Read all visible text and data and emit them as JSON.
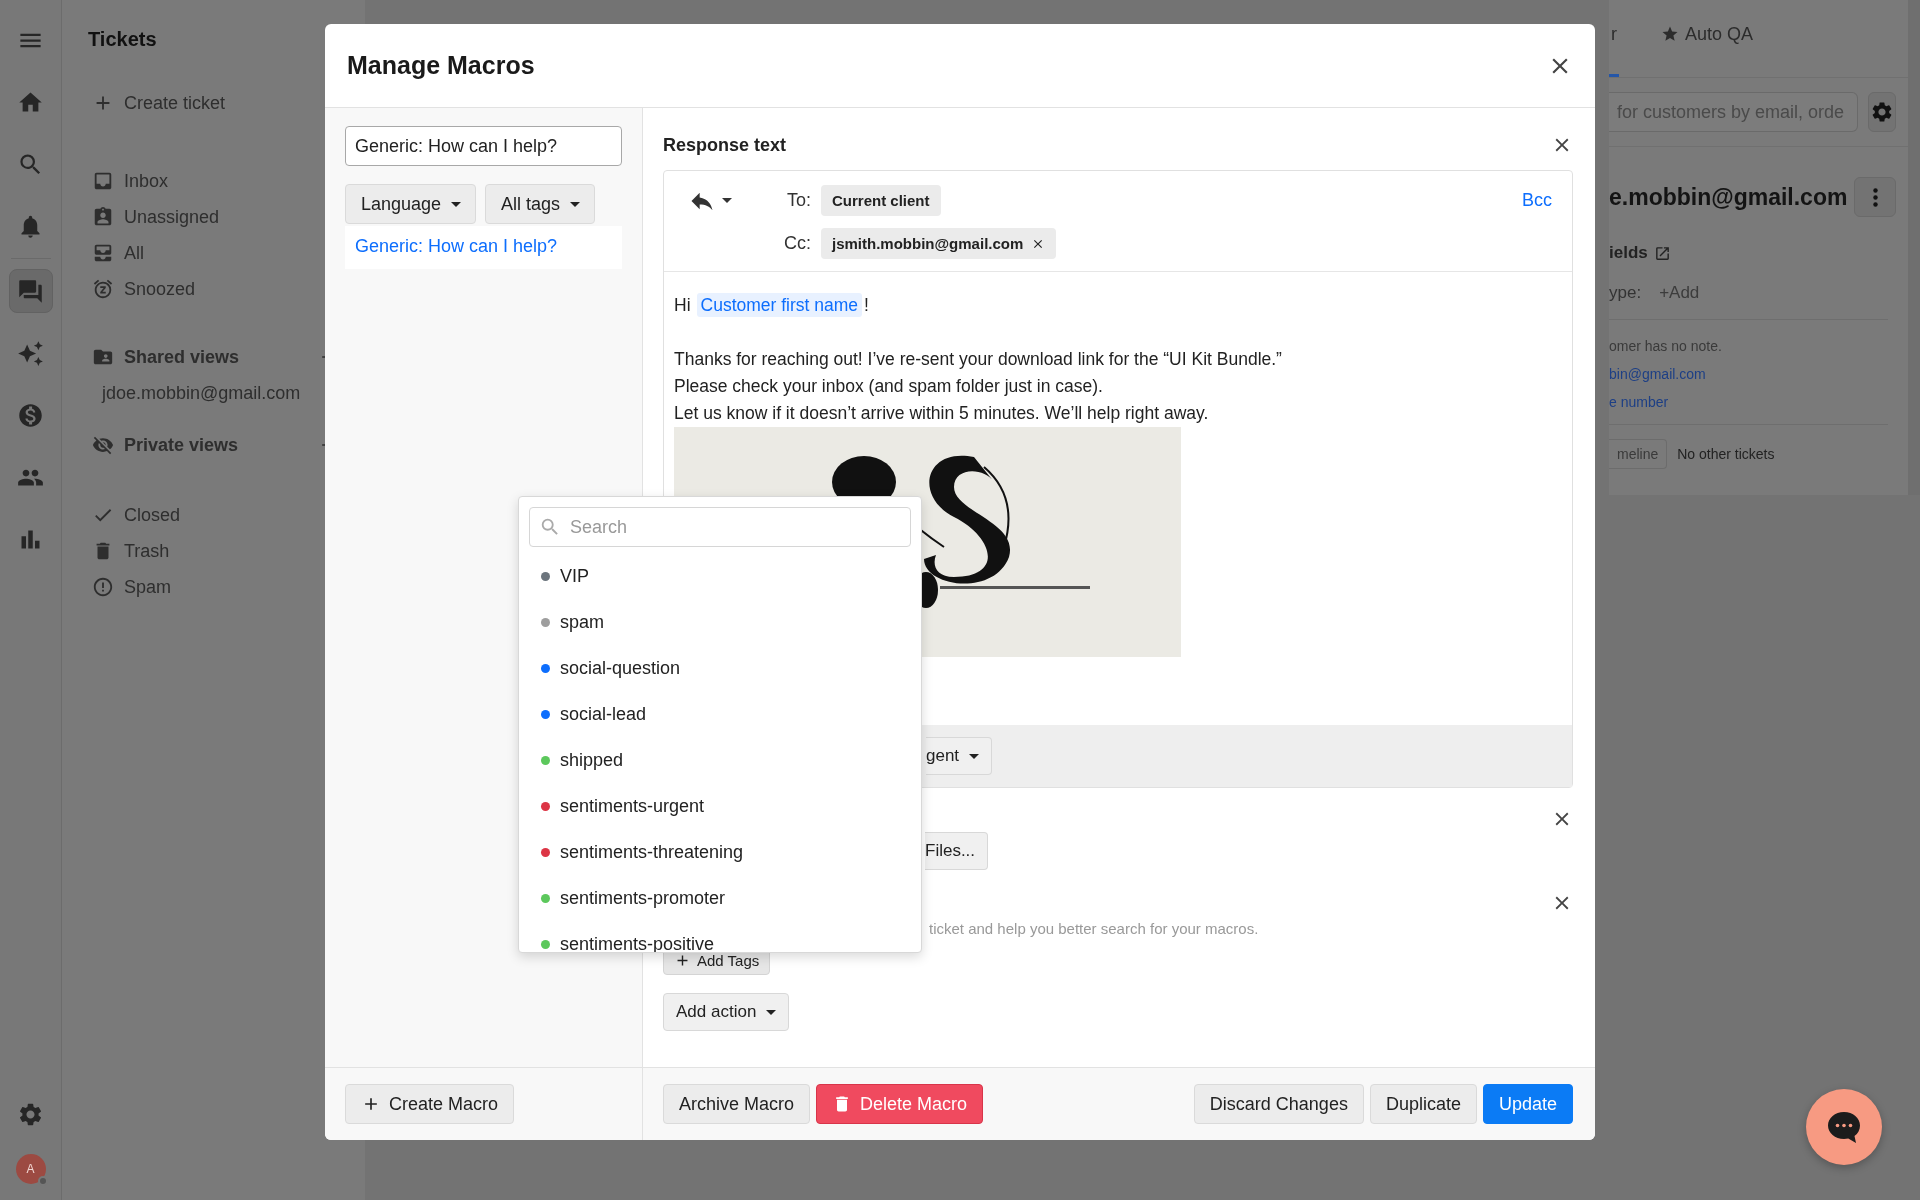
{
  "rail": {
    "items": [
      {
        "selected": false
      },
      {
        "selected": false
      },
      {
        "selected": false
      },
      {
        "selected": false
      },
      {
        "selected": true
      },
      {
        "selected": false
      },
      {
        "selected": false
      },
      {
        "selected": false
      },
      {
        "selected": false
      }
    ],
    "avatar": "A"
  },
  "tickets_panel": {
    "title": "Tickets",
    "create": "Create ticket",
    "folders": [
      "Inbox",
      "Unassigned",
      "All",
      "Snoozed"
    ],
    "shared_views": {
      "title": "Shared views",
      "items": [
        "jdoe.mobbin@gmail.com"
      ]
    },
    "private_views": {
      "title": "Private views"
    },
    "status_folders": [
      "Closed",
      "Trash",
      "Spam"
    ]
  },
  "customer_panel": {
    "tabs": [
      {
        "label": "r",
        "selected": true
      },
      {
        "label": "Auto QA",
        "selected": false
      }
    ],
    "search_placeholder": "for customers by email, orde",
    "customer_email": "e.mobbin@gmail.com",
    "fields_title": "ields",
    "field": {
      "label": "ype:",
      "value": "+Add"
    },
    "note": "omer has no note.",
    "email_link": "bin@gmail.com",
    "phone_link": "e number",
    "timeline_button": "meline",
    "other_tickets": "No other tickets"
  },
  "modal": {
    "title": "Manage Macros",
    "macro_search": "Generic: How can I help?",
    "filters": [
      "Language",
      "All tags"
    ],
    "macros": [
      {
        "label": "Generic: How can I help?",
        "selected": true
      }
    ],
    "response": {
      "title": "Response text",
      "to_label": "To:",
      "to_chip": "Current client",
      "bcc": "Bcc",
      "cc_label": "Cc:",
      "cc_chips": [
        "jsmith.mobbin@gmail.com"
      ],
      "greeting": "Hi",
      "variable": "Customer first name",
      "greeting_end": "!",
      "lines": [
        "Thanks for reaching out! I’ve re-sent your download link for the “UI Kit Bundle.”",
        "Please check your inbox (and spam folder just in case).",
        "Let us know if it doesn’t arrive within 5 minutes. We’ll help right away."
      ],
      "image": {
        "kind": "picture"
      },
      "sender_button": "gent"
    },
    "attachments": {
      "button": "Files..."
    },
    "tags": {
      "hint": "ticket and help you better search for your macros.",
      "add_button": "Add Tags"
    },
    "add_action": "Add action",
    "create_button": "Create Macro",
    "footer_buttons": [
      {
        "label": "Archive Macro",
        "kind": "default"
      },
      {
        "label": "Delete Macro",
        "kind": "danger"
      },
      {
        "label": "Discard Changes",
        "kind": "default"
      },
      {
        "label": "Duplicate",
        "kind": "default"
      },
      {
        "label": "Update",
        "kind": "primary"
      }
    ],
    "tag_dropdown": {
      "search_placeholder": "Search",
      "tags": [
        {
          "label": "VIP",
          "color": "#6c757d"
        },
        {
          "label": "spam",
          "color": "#9e9e9e"
        },
        {
          "label": "social-question",
          "color": "#0d6efd"
        },
        {
          "label": "social-lead",
          "color": "#0d6efd"
        },
        {
          "label": "shipped",
          "color": "#5cc85c"
        },
        {
          "label": "sentiments-urgent",
          "color": "#dc3545"
        },
        {
          "label": "sentiments-threatening",
          "color": "#dc3545"
        },
        {
          "label": "sentiments-promoter",
          "color": "#5cc85c"
        },
        {
          "label": "sentiments-positive",
          "color": "#5cc85c"
        }
      ]
    }
  }
}
